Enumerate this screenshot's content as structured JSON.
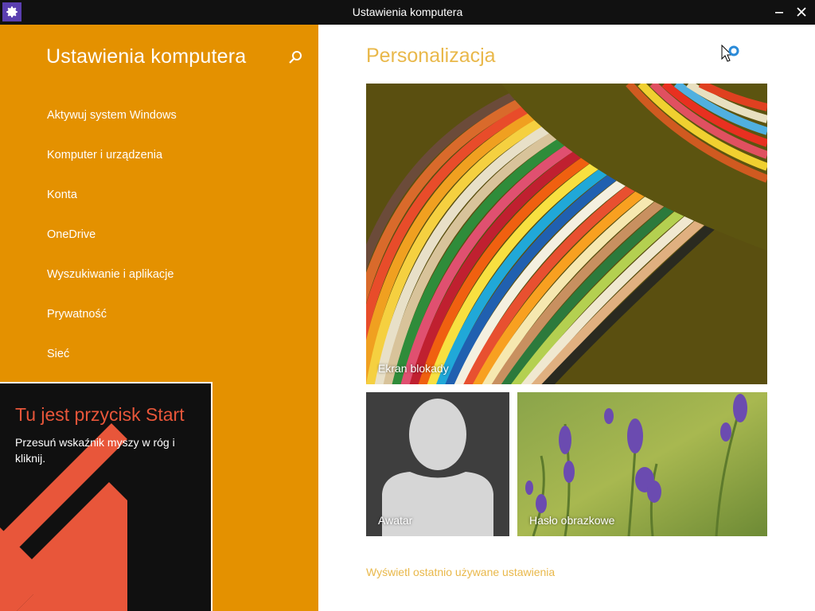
{
  "window": {
    "title": "Ustawienia komputera",
    "icon": "gear-icon",
    "minimize_icon": "minimize-icon",
    "close_icon": "close-icon"
  },
  "sidebar": {
    "heading": "Ustawienia komputera",
    "search_icon": "search-icon",
    "background": "#e49100",
    "items": [
      {
        "label": "Aktywuj system Windows"
      },
      {
        "label": "Komputer i urządzenia"
      },
      {
        "label": "Konta"
      },
      {
        "label": "OneDrive"
      },
      {
        "label": "Wyszukiwanie i aplikacje"
      },
      {
        "label": "Prywatność"
      },
      {
        "label": "Sieć"
      }
    ]
  },
  "tooltip": {
    "title": "Tu jest przycisk Start",
    "text": "Przesuń wskaźnik myszy w róg i kliknij.",
    "arrow_color": "#e8563a"
  },
  "main": {
    "heading": "Personalizacja",
    "accent": "#e9b84a",
    "tiles": {
      "lock_screen": "Ekran blokady",
      "avatar": "Awatar",
      "picture_password": "Hasło obrazkowe"
    },
    "recent_link": "Wyświetl ostatnio używane ustawienia"
  }
}
